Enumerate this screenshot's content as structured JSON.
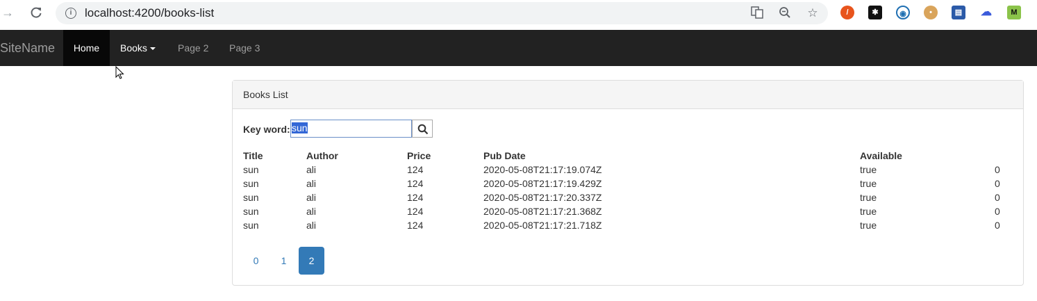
{
  "browser": {
    "url": "localhost:4200/books-list"
  },
  "navbar": {
    "brand": "SiteName",
    "items": [
      {
        "label": "Home"
      },
      {
        "label": "Books"
      },
      {
        "label": "Page 2"
      },
      {
        "label": "Page 3"
      }
    ]
  },
  "panel": {
    "title": "Books List",
    "search": {
      "label": "Key word:",
      "value": "sun"
    },
    "table": {
      "headers": [
        "Title",
        "Author",
        "Price",
        "Pub Date",
        "Available",
        ""
      ],
      "rows": [
        [
          "sun",
          "ali",
          "124",
          "2020-05-08T21:17:19.074Z",
          "true",
          "0"
        ],
        [
          "sun",
          "ali",
          "124",
          "2020-05-08T21:17:19.429Z",
          "true",
          "0"
        ],
        [
          "sun",
          "ali",
          "124",
          "2020-05-08T21:17:20.337Z",
          "true",
          "0"
        ],
        [
          "sun",
          "ali",
          "124",
          "2020-05-08T21:17:21.368Z",
          "true",
          "0"
        ],
        [
          "sun",
          "ali",
          "124",
          "2020-05-08T21:17:21.718Z",
          "true",
          "0"
        ]
      ]
    },
    "pagination": {
      "pages": [
        "0",
        "1",
        "2"
      ],
      "active_index": 2
    }
  },
  "colors": {
    "navbar_bg": "#222222",
    "accent": "#337ab7"
  }
}
